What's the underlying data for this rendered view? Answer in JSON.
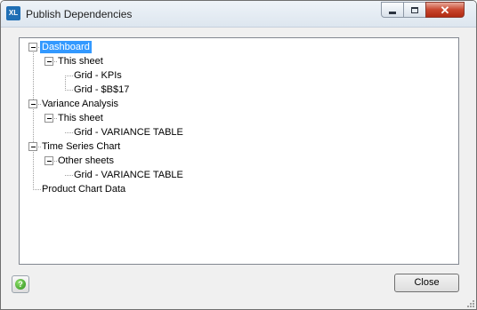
{
  "window": {
    "app_icon_text": "XL",
    "title": "Publish Dependencies"
  },
  "tree": [
    {
      "label": "Dashboard",
      "depth": 0,
      "expander": "minus",
      "selected": true
    },
    {
      "label": "This sheet",
      "depth": 1,
      "expander": "minus"
    },
    {
      "label": "Grid - KPIs",
      "depth": 2,
      "expander": "none"
    },
    {
      "label": "Grid - $B$17",
      "depth": 2,
      "expander": "none"
    },
    {
      "label": "Variance Analysis",
      "depth": 0,
      "expander": "minus"
    },
    {
      "label": "This sheet",
      "depth": 1,
      "expander": "minus"
    },
    {
      "label": "Grid - VARIANCE TABLE",
      "depth": 2,
      "expander": "none"
    },
    {
      "label": "Time Series Chart",
      "depth": 0,
      "expander": "minus"
    },
    {
      "label": "Other sheets",
      "depth": 1,
      "expander": "minus"
    },
    {
      "label": "Grid - VARIANCE TABLE",
      "depth": 2,
      "expander": "none"
    },
    {
      "label": "Product Chart Data",
      "depth": 0,
      "expander": "none"
    }
  ],
  "footer": {
    "help_icon": "help-icon",
    "help_glyph": "?",
    "close_label": "Close"
  },
  "colors": {
    "selection": "#3399ff",
    "tree_lines": "#a0a0a0",
    "expander_border": "#919191"
  }
}
